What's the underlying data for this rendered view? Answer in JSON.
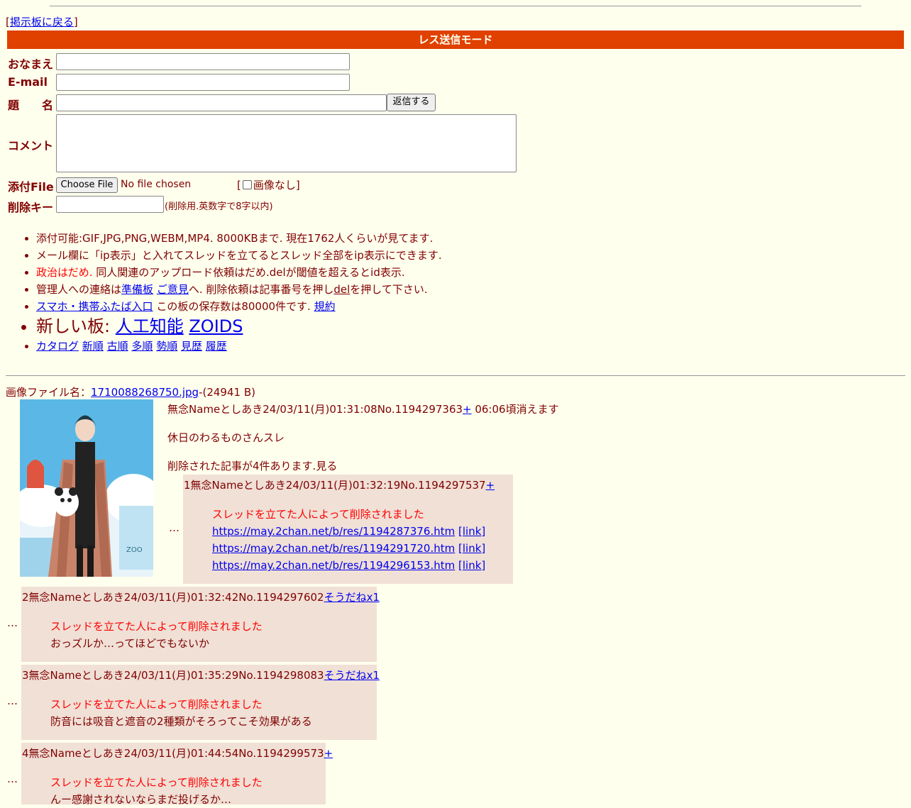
{
  "nav": {
    "back_open": "[",
    "back_link": "掲示板に戻る",
    "back_close": "]"
  },
  "mode_title": "レス送信モード",
  "form": {
    "name_label": "おなまえ",
    "email_label": "E-mail",
    "subject_label": "題　　名",
    "submit_label": "返信する",
    "comment_label": "コメント",
    "file_label": "添付File",
    "choose_file_label": "Choose File",
    "no_file_text": "No file chosen",
    "noimg_open": "[",
    "noimg_label": "画像なし",
    "noimg_close": "]",
    "delkey_label": "削除キー",
    "delkey_note": "(削除用.英数字で8字以内)"
  },
  "rules": {
    "r1": "添付可能:GIF,JPG,PNG,WEBM,MP4. 8000KBまで. 現在1762人くらいが見てます.",
    "r2": "メール欄に「ip表示」と入れてスレッドを立てるとスレッド全部をip表示にできます.",
    "r3_red": "政治はだめ.",
    "r3_rest": " 同人関連のアップロード依頼はだめ.delが閾値を超えるとid表示.",
    "r4_a": "管理人への連絡は",
    "r4_link1": "準備板",
    "r4_link2": "ご意見",
    "r4_b": "へ. 削除依頼は記事番号を押し",
    "r4_del": "del",
    "r4_c": "を押して下さい.",
    "r5_link": "スマホ・携帯ふたば入口",
    "r5_text": " この板の保存数は80000件です. ",
    "r5_rule": "規約",
    "r6_text": "新しい板: ",
    "r6_link1": "人工知能",
    "r6_link2": "ZOIDS",
    "r7": [
      "カタログ",
      "新順",
      "古順",
      "多順",
      "勢順",
      "見歴",
      "履歴"
    ]
  },
  "thread": {
    "file_prefix": "画像ファイル名：",
    "file_name": "1710088268750.jpg",
    "file_size": "-(24941 B)",
    "op_header": "無念Nameとしあき24/03/11(月)01:31:08No.1194297363",
    "op_plus": "+",
    "op_expire": " 06:06頃消えます",
    "op_body": "休日のわるものさんスレ",
    "op_deleted": "削除された記事が4件あります.見る",
    "dots": "…",
    "replies": [
      {
        "header": "1無念Nameとしあき24/03/11(月)01:32:19No.1194297537",
        "sodane": "+",
        "deleted": "スレッドを立てた人によって削除されました",
        "links": [
          "https://may.2chan.net/b/res/1194287376.htm",
          "https://may.2chan.net/b/res/1194291720.htm",
          "https://may.2chan.net/b/res/1194296153.htm"
        ],
        "link_label": "[link]"
      },
      {
        "header": "2無念Nameとしあき24/03/11(月)01:32:42No.1194297602",
        "sodane": "そうだねx1",
        "deleted": "スレッドを立てた人によって削除されました",
        "text": "おっズルか…ってほどでもないか"
      },
      {
        "header": "3無念Nameとしあき24/03/11(月)01:35:29No.1194298083",
        "sodane": "そうだねx1",
        "deleted": "スレッドを立てた人によって削除されました",
        "text": "防音には吸音と遮音の2種類がそろってこそ効果がある"
      },
      {
        "header": "4無念Nameとしあき24/03/11(月)01:44:54No.1194299573",
        "sodane": "+",
        "deleted": "スレッドを立てた人によって削除されました",
        "text": "んー感謝されないならまだ投げるか…"
      }
    ]
  },
  "colors": {
    "background": "#ffffee",
    "text": "#800000",
    "mode_bar": "#e04000",
    "reply_bg": "#f0e0d6",
    "link": "#0000ee"
  }
}
